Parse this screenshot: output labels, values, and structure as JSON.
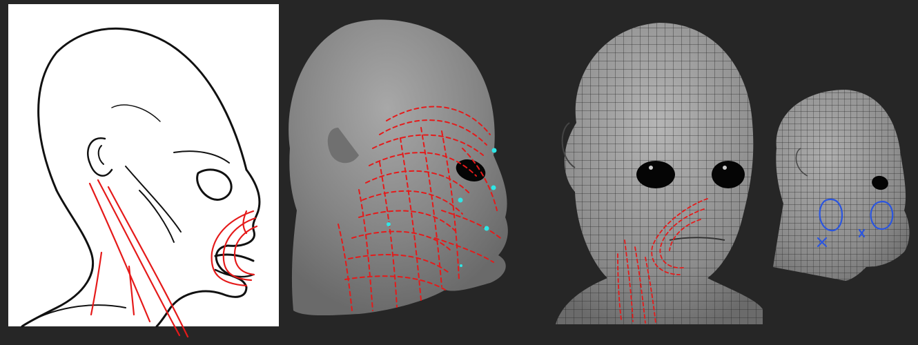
{
  "colors": {
    "background": "#262626",
    "ink": "#111111",
    "red_strokes": "#e51a1a",
    "cyan_dots": "#2ee6e6",
    "blue_marks": "#2a55e0",
    "grey_head": "#8a8a8a",
    "mesh_grid": "#2a2a2a"
  }
}
